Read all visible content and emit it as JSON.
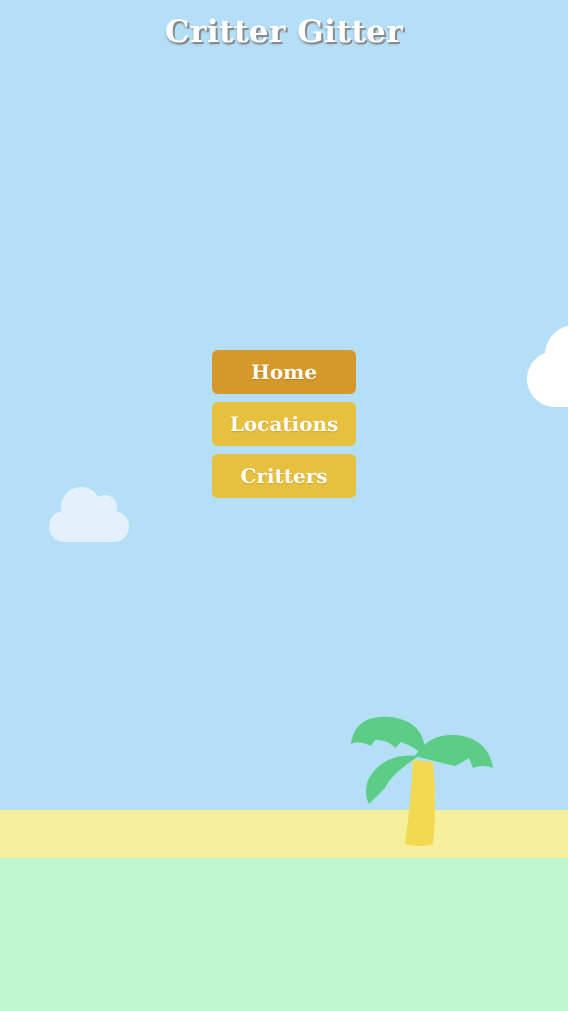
{
  "header": {
    "title": "Critter Gitter"
  },
  "nav": {
    "items": [
      {
        "label": "Home",
        "active": true
      },
      {
        "label": "Locations",
        "active": false
      },
      {
        "label": "Critters",
        "active": false
      }
    ]
  },
  "colors": {
    "sky": "#b5dff7",
    "button": "#e8c040",
    "button_active": "#d4992a",
    "sand": "#f6ef9b",
    "grass": "#bef6cf",
    "palm_leaves": "#5ccd86",
    "palm_trunk": "#f3d94f",
    "cloud": "#ffffff"
  },
  "decorations": {
    "icons": [
      "cloud-icon",
      "cloud-icon",
      "palm-tree-icon"
    ]
  }
}
